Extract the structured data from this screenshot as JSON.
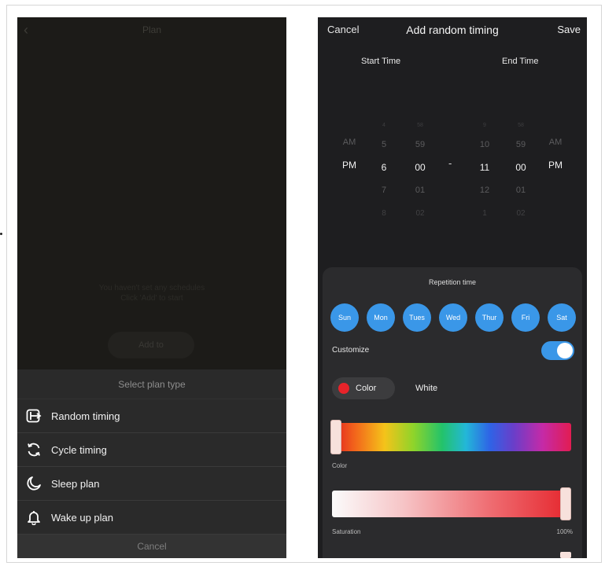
{
  "left_screen": {
    "header": {
      "back_glyph": "‹",
      "title": "Plan"
    },
    "empty_state": {
      "line1": "You haven't set any schedules",
      "line2": "Click 'Add' to start",
      "add_button": "Add to"
    },
    "plan_sheet": {
      "title": "Select plan type",
      "items": [
        {
          "label": "Random timing",
          "icon": "random-timing-icon"
        },
        {
          "label": "Cycle timing",
          "icon": "cycle-timing-icon"
        },
        {
          "label": "Sleep plan",
          "icon": "sleep-plan-icon"
        },
        {
          "label": "Wake up plan",
          "icon": "wake-up-bell-icon"
        }
      ],
      "cancel": "Cancel"
    }
  },
  "right_screen": {
    "header": {
      "cancel": "Cancel",
      "title": "Add random timing",
      "save": "Save"
    },
    "start_time_label": "Start Time",
    "end_time_label": "End Time",
    "picker": {
      "start_ampm": [
        "",
        "",
        "AM",
        "PM",
        "",
        ""
      ],
      "start_hour": [
        "4",
        "5",
        "6",
        "7",
        "8"
      ],
      "start_minute": [
        "58",
        "59",
        "00",
        "01",
        "02"
      ],
      "separator": "-",
      "end_hour": [
        "9",
        "10",
        "11",
        "12",
        "1"
      ],
      "end_minute": [
        "58",
        "59",
        "00",
        "01",
        "02"
      ],
      "end_ampm": [
        "",
        "",
        "AM",
        "PM",
        "",
        ""
      ],
      "selected": {
        "start_ampm": "PM",
        "start_hour": "6",
        "start_minute": "00",
        "end_hour": "11",
        "end_minute": "00",
        "end_ampm": "PM"
      }
    },
    "repetition": {
      "title": "Repetition time",
      "days": [
        "Sun",
        "Mon",
        "Tues",
        "Wed",
        "Thur",
        "Fri",
        "Sat"
      ]
    },
    "customize": {
      "label": "Customize",
      "enabled": true
    },
    "mode": {
      "color_label": "Color",
      "white_label": "White",
      "selected": "Color"
    },
    "color_slider": {
      "label": "Color",
      "value_fraction": 0.0
    },
    "saturation_slider": {
      "label": "Saturation",
      "value": "100%"
    },
    "accent_color": "#3a97e8",
    "color_dot": "#e8232a"
  }
}
